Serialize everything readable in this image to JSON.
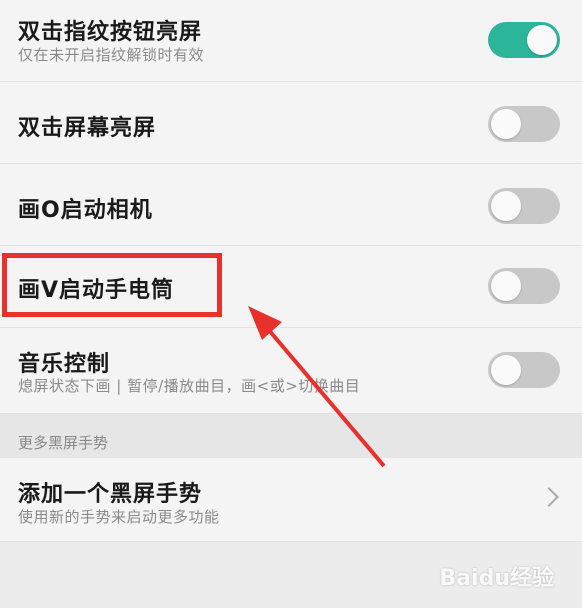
{
  "settings": [
    {
      "title": "双击指纹按钮亮屏",
      "subtitle": "仅在未开启指纹解锁时有效",
      "on": true
    },
    {
      "title": "双击屏幕亮屏",
      "subtitle": "",
      "on": false
    },
    {
      "title": "画O启动相机",
      "subtitle": "",
      "on": false
    },
    {
      "title": "画V启动手电筒",
      "subtitle": "",
      "on": false
    },
    {
      "title": "音乐控制",
      "subtitle": "熄屏状态下画 | 暂停/播放曲目，画<或>切换曲目",
      "on": false
    }
  ],
  "section_header": "更多黑屏手势",
  "add_gesture": {
    "title": "添加一个黑屏手势",
    "subtitle": "使用新的手势来启动更多功能"
  },
  "watermark": "Baidu经验",
  "colors": {
    "toggle_on": "#2bb59b",
    "toggle_off": "#c8c8c8",
    "highlight": "#e8312d",
    "arrow": "#e8312d"
  }
}
